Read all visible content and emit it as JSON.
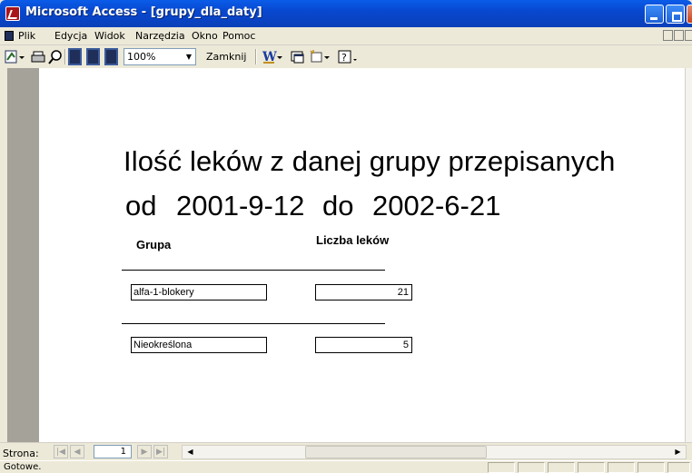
{
  "window": {
    "title": "Microsoft Access - [grupy_dla_daty]"
  },
  "menu": {
    "items": [
      "Plik",
      "Edycja",
      "Widok",
      "Narzędzia",
      "Okno",
      "Pomoc"
    ]
  },
  "toolbar": {
    "zoom_value": "100%",
    "close_label": "Zamknij",
    "icons": [
      "view-icon",
      "print-icon",
      "zoom-icon",
      "one-page-icon",
      "two-pages-icon",
      "multiple-pages-icon",
      "word-icon",
      "database-window-icon",
      "new-object-icon",
      "help-icon"
    ]
  },
  "report": {
    "title": "Ilość leków z danej grupy przepisanych",
    "label_from": "od",
    "date_from": "2001-9-12",
    "label_to": "do",
    "date_to": "2002-6-21",
    "header_group": "Grupa",
    "header_count": "Liczba leków",
    "rows": [
      {
        "group": "alfa-1-blokery",
        "count": "21"
      },
      {
        "group": "Nieokreślona",
        "count": "5"
      }
    ]
  },
  "navigation": {
    "label": "Strona:",
    "page": "1"
  },
  "status": {
    "text": "Gotowe."
  },
  "colors": {
    "titlebar": "#0a5ce8",
    "background": "#ece9d8",
    "report_margin": "#a5a29a"
  }
}
